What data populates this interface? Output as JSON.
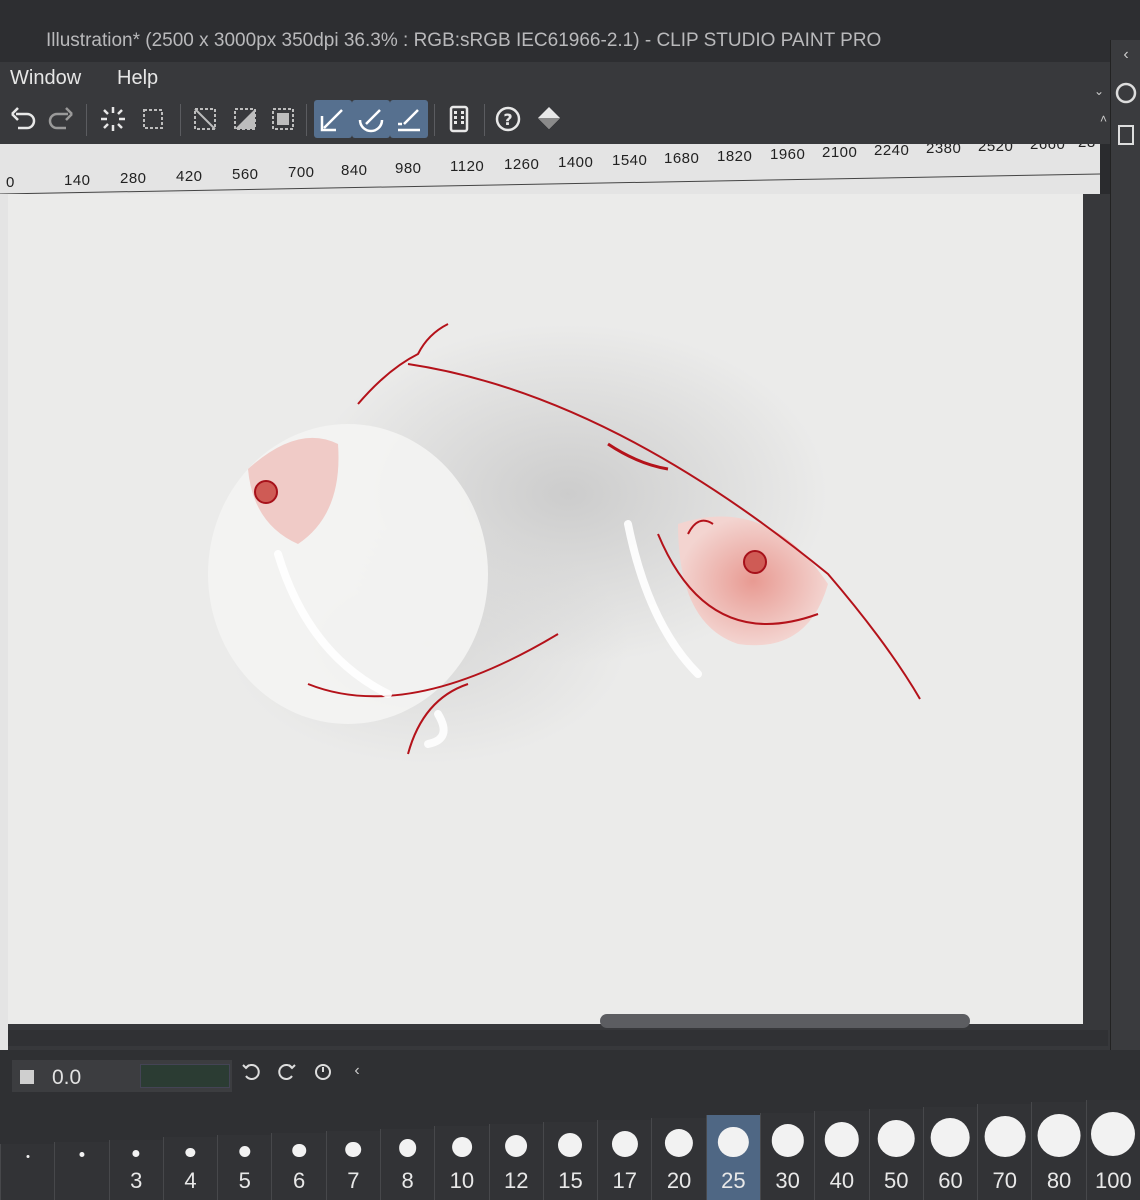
{
  "window": {
    "title": "Illustration* (2500 x 3000px 350dpi 36.3% : RGB:sRGB IEC61966-2.1)  - CLIP STUDIO PAINT PRO"
  },
  "menu": {
    "items": [
      "Window",
      "Help"
    ]
  },
  "toolbar": {
    "icons": [
      "undo-icon",
      "redo-icon",
      "select-all-icon",
      "deselect-icon",
      "clear-outside-icon",
      "clear-inside-icon",
      "crop-icon",
      "snap-to-ruler-icon",
      "snap-to-special-ruler-icon",
      "snap-to-grid-icon",
      "device-icon",
      "help-icon",
      "fill-icon"
    ]
  },
  "ruler": {
    "labels": [
      "0",
      "140",
      "280",
      "420",
      "560",
      "700",
      "840",
      "980",
      "1120",
      "1260",
      "1400",
      "1540",
      "1680",
      "1820",
      "1960",
      "2100",
      "2240",
      "2380",
      "2520",
      "2660",
      "28"
    ]
  },
  "navigator": {
    "zoom_value": "0.0"
  },
  "brush_sizes": {
    "labels": [
      "",
      "",
      "3",
      "4",
      "5",
      "6",
      "7",
      "8",
      "10",
      "12",
      "15",
      "17",
      "20",
      "25",
      "30",
      "40",
      "50",
      "60",
      "70",
      "80",
      "100"
    ],
    "selected": "25"
  },
  "colors": {
    "accent_active": "#56708f",
    "line_red": "#b4121a",
    "shade_red": "#e0847e",
    "canvas_paper": "#ebebea"
  }
}
